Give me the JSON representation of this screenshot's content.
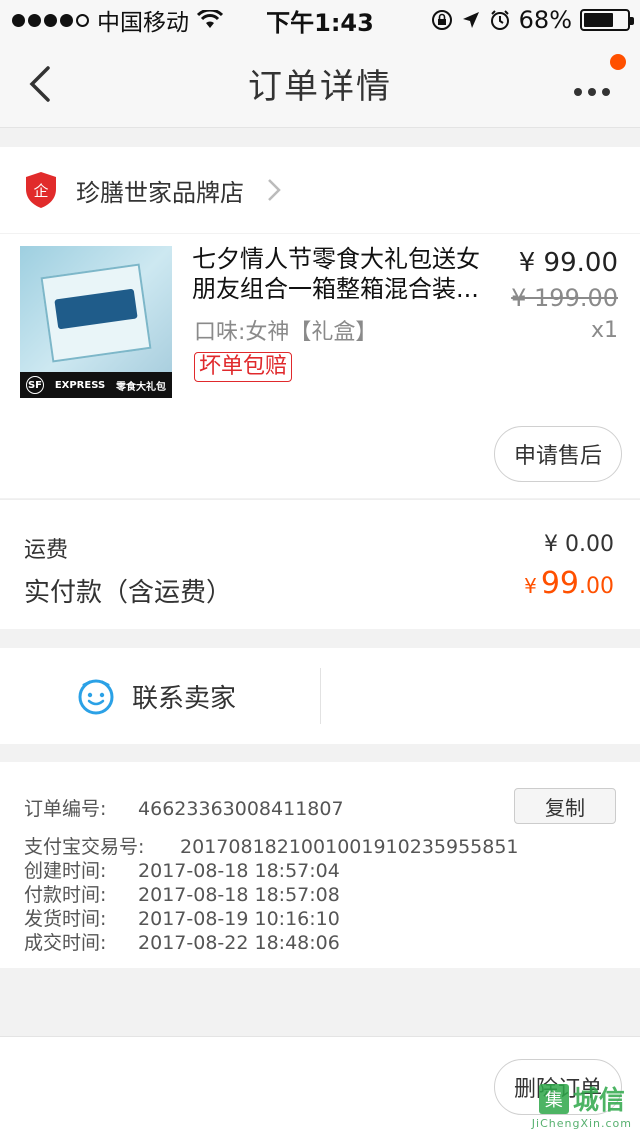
{
  "status_bar": {
    "carrier": "中国移动",
    "time": "下午1:43",
    "battery": "68%",
    "battery_level": 0.68
  },
  "nav": {
    "title": "订单详情"
  },
  "shop": {
    "name": "珍膳世家品牌店",
    "badge": "企"
  },
  "item": {
    "title": "七夕情人节零食大礼包送女朋友组合一箱整箱混合装...",
    "flavor": "口味:女神【礼盒】",
    "tag": "坏单包赔",
    "price": "¥ 99.00",
    "original_price": "¥ 199.00",
    "quantity": "x1",
    "thumb_text": "零食大礼包",
    "thumb_sf": "SF",
    "thumb_express": "EXPRESS",
    "after_sale_label": "申请售后"
  },
  "fees": {
    "shipping_label": "运费",
    "shipping_value": "¥ 0.00",
    "paid_label": "实付款（含运费）",
    "paid_currency": "¥",
    "paid_int": "99",
    "paid_dec": ".00"
  },
  "contact": {
    "label": "联系卖家"
  },
  "order_info": {
    "rows": [
      {
        "label": "订单编号:",
        "value": "46623363008411807"
      },
      {
        "label": "支付宝交易号:",
        "value": "2017081821001001910235955851"
      },
      {
        "label": "创建时间:",
        "value": "2017-08-18 18:57:04"
      },
      {
        "label": "付款时间:",
        "value": "2017-08-18 18:57:08"
      },
      {
        "label": "发货时间:",
        "value": "2017-08-19 10:16:10"
      },
      {
        "label": "成交时间:",
        "value": "2017-08-22 18:48:06"
      }
    ],
    "copy_label": "复制"
  },
  "bottom": {
    "delete_label": "删除订单"
  },
  "watermark": {
    "cn": "城信",
    "box": "集",
    "url": "JiChengXin.com"
  },
  "colors": {
    "accent": "#ff5000",
    "tag_red": "#e0292c",
    "contact_blue": "#2ba1e6"
  }
}
